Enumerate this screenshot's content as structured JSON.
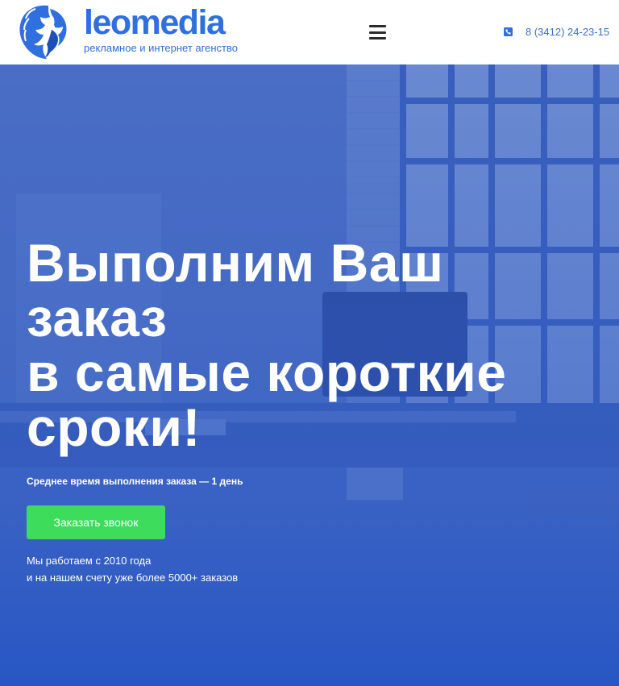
{
  "header": {
    "logo_name": "leomedia",
    "logo_tagline": "рекламное и интернет агенство",
    "phone": "8 (3412) 24-23-15"
  },
  "hero": {
    "title_lines": [
      "Выполним Ваш",
      "заказ",
      "в самые короткие",
      "сроки!"
    ],
    "subtitle": "Среднее время выполнения заказа — 1 день",
    "cta_label": "Заказать звонок",
    "about_lines": [
      "Мы работаем с 2010 года",
      "и на нашем счету уже более 5000+ заказов"
    ]
  },
  "icons": {
    "logo": "lion-head-icon",
    "menu": "hamburger-menu-icon",
    "phone": "phone-icon"
  },
  "colors": {
    "brand_blue": "#2f6fe0",
    "hero_overlay": "#2a59c3",
    "cta_green": "#3ddc5a",
    "header_bg": "#ffffff"
  }
}
